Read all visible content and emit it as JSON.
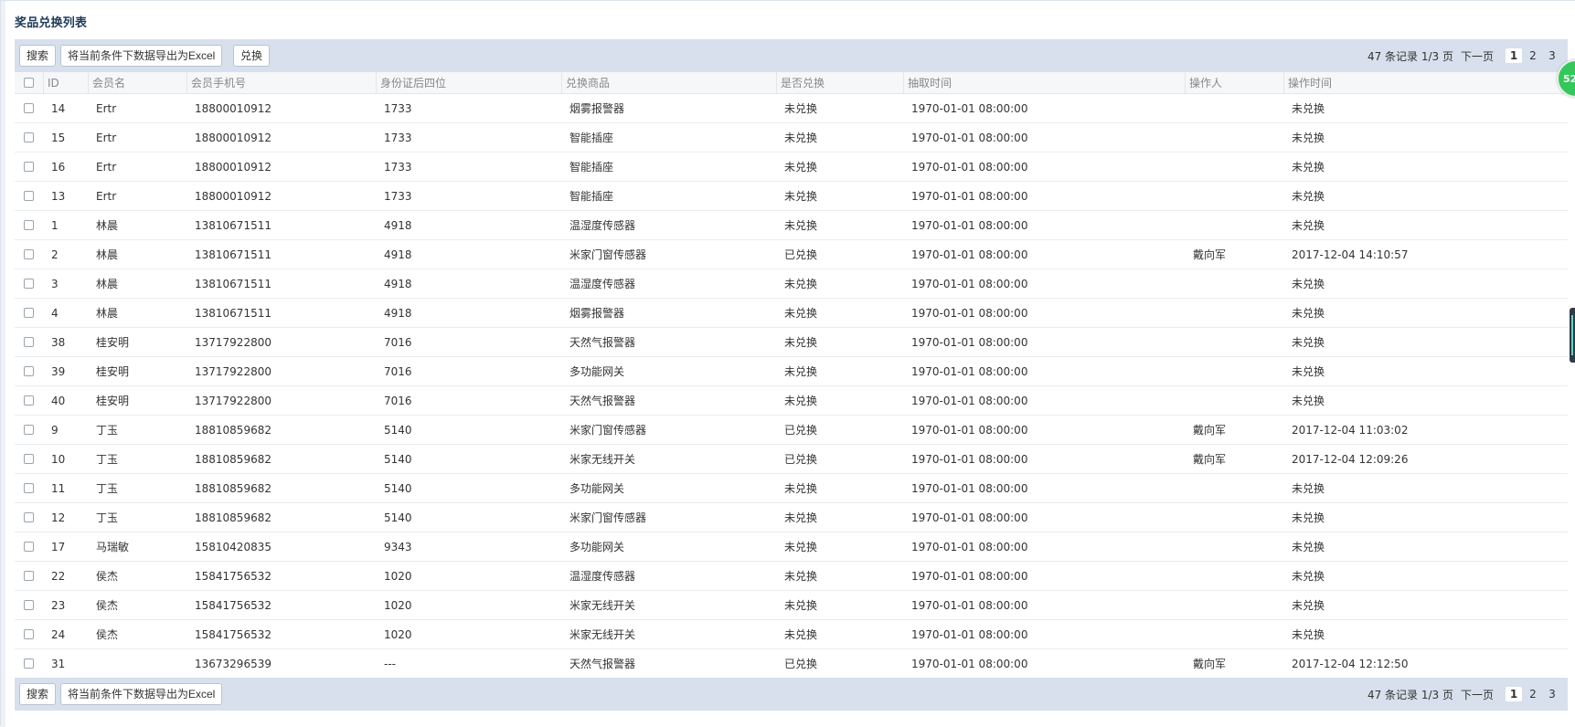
{
  "page": {
    "title": "奖品兑换列表"
  },
  "toolbar": {
    "search_label": "搜索",
    "export_label": "将当前条件下数据导出为Excel",
    "redeem_label": "兑换"
  },
  "pager": {
    "info": "47 条记录 1/3 页",
    "next_label": "下一页",
    "pages": [
      "1",
      "2",
      "3"
    ],
    "current_page": "1"
  },
  "table": {
    "headers": {
      "id": "ID",
      "member_name": "会员名",
      "member_phone": "会员手机号",
      "id_last4": "身份证后四位",
      "item": "兑换商品",
      "redeemed": "是否兑换",
      "draw_time": "抽取时间",
      "operator": "操作人",
      "op_time": "操作时间"
    },
    "rows": [
      {
        "id": "14",
        "name": "Ertr",
        "phone": "18800010912",
        "idno": "1733",
        "item": "烟雾报警器",
        "status": "未兑换",
        "draw": "1970-01-01 08:00:00",
        "op": "",
        "optime": "未兑换"
      },
      {
        "id": "15",
        "name": "Ertr",
        "phone": "18800010912",
        "idno": "1733",
        "item": "智能插座",
        "status": "未兑换",
        "draw": "1970-01-01 08:00:00",
        "op": "",
        "optime": "未兑换"
      },
      {
        "id": "16",
        "name": "Ertr",
        "phone": "18800010912",
        "idno": "1733",
        "item": "智能插座",
        "status": "未兑换",
        "draw": "1970-01-01 08:00:00",
        "op": "",
        "optime": "未兑换"
      },
      {
        "id": "13",
        "name": "Ertr",
        "phone": "18800010912",
        "idno": "1733",
        "item": "智能插座",
        "status": "未兑换",
        "draw": "1970-01-01 08:00:00",
        "op": "",
        "optime": "未兑换"
      },
      {
        "id": "1",
        "name": "林晨",
        "phone": "13810671511",
        "idno": "4918",
        "item": "温湿度传感器",
        "status": "未兑换",
        "draw": "1970-01-01 08:00:00",
        "op": "",
        "optime": "未兑换"
      },
      {
        "id": "2",
        "name": "林晨",
        "phone": "13810671511",
        "idno": "4918",
        "item": "米家门窗传感器",
        "status": "已兑换",
        "draw": "1970-01-01 08:00:00",
        "op": "戴向军",
        "optime": "2017-12-04 14:10:57"
      },
      {
        "id": "3",
        "name": "林晨",
        "phone": "13810671511",
        "idno": "4918",
        "item": "温湿度传感器",
        "status": "未兑换",
        "draw": "1970-01-01 08:00:00",
        "op": "",
        "optime": "未兑换"
      },
      {
        "id": "4",
        "name": "林晨",
        "phone": "13810671511",
        "idno": "4918",
        "item": "烟雾报警器",
        "status": "未兑换",
        "draw": "1970-01-01 08:00:00",
        "op": "",
        "optime": "未兑换"
      },
      {
        "id": "38",
        "name": "桂安明",
        "phone": "13717922800",
        "idno": "7016",
        "item": "天然气报警器",
        "status": "未兑换",
        "draw": "1970-01-01 08:00:00",
        "op": "",
        "optime": "未兑换"
      },
      {
        "id": "39",
        "name": "桂安明",
        "phone": "13717922800",
        "idno": "7016",
        "item": "多功能网关",
        "status": "未兑换",
        "draw": "1970-01-01 08:00:00",
        "op": "",
        "optime": "未兑换"
      },
      {
        "id": "40",
        "name": "桂安明",
        "phone": "13717922800",
        "idno": "7016",
        "item": "天然气报警器",
        "status": "未兑换",
        "draw": "1970-01-01 08:00:00",
        "op": "",
        "optime": "未兑换"
      },
      {
        "id": "9",
        "name": "丁玉",
        "phone": "18810859682",
        "idno": "5140",
        "item": "米家门窗传感器",
        "status": "已兑换",
        "draw": "1970-01-01 08:00:00",
        "op": "戴向军",
        "optime": "2017-12-04 11:03:02"
      },
      {
        "id": "10",
        "name": "丁玉",
        "phone": "18810859682",
        "idno": "5140",
        "item": "米家无线开关",
        "status": "已兑换",
        "draw": "1970-01-01 08:00:00",
        "op": "戴向军",
        "optime": "2017-12-04 12:09:26"
      },
      {
        "id": "11",
        "name": "丁玉",
        "phone": "18810859682",
        "idno": "5140",
        "item": "多功能网关",
        "status": "未兑换",
        "draw": "1970-01-01 08:00:00",
        "op": "",
        "optime": "未兑换"
      },
      {
        "id": "12",
        "name": "丁玉",
        "phone": "18810859682",
        "idno": "5140",
        "item": "米家门窗传感器",
        "status": "未兑换",
        "draw": "1970-01-01 08:00:00",
        "op": "",
        "optime": "未兑换"
      },
      {
        "id": "17",
        "name": "马瑞敏",
        "phone": "15810420835",
        "idno": "9343",
        "item": "多功能网关",
        "status": "未兑换",
        "draw": "1970-01-01 08:00:00",
        "op": "",
        "optime": "未兑换"
      },
      {
        "id": "22",
        "name": "侯杰",
        "phone": "15841756532",
        "idno": "1020",
        "item": "温湿度传感器",
        "status": "未兑换",
        "draw": "1970-01-01 08:00:00",
        "op": "",
        "optime": "未兑换"
      },
      {
        "id": "23",
        "name": "侯杰",
        "phone": "15841756532",
        "idno": "1020",
        "item": "米家无线开关",
        "status": "未兑换",
        "draw": "1970-01-01 08:00:00",
        "op": "",
        "optime": "未兑换"
      },
      {
        "id": "24",
        "name": "侯杰",
        "phone": "15841756532",
        "idno": "1020",
        "item": "米家无线开关",
        "status": "未兑换",
        "draw": "1970-01-01 08:00:00",
        "op": "",
        "optime": "未兑换"
      },
      {
        "id": "31",
        "name": "",
        "phone": "13673296539",
        "idno": "---",
        "item": "天然气报警器",
        "status": "已兑换",
        "draw": "1970-01-01 08:00:00",
        "op": "戴向军",
        "optime": "2017-12-04 12:12:50"
      }
    ]
  },
  "widgets": {
    "floating_badge_text": "52",
    "badge_color": "#34c759",
    "toolbar_color": "#d7e0ec"
  }
}
